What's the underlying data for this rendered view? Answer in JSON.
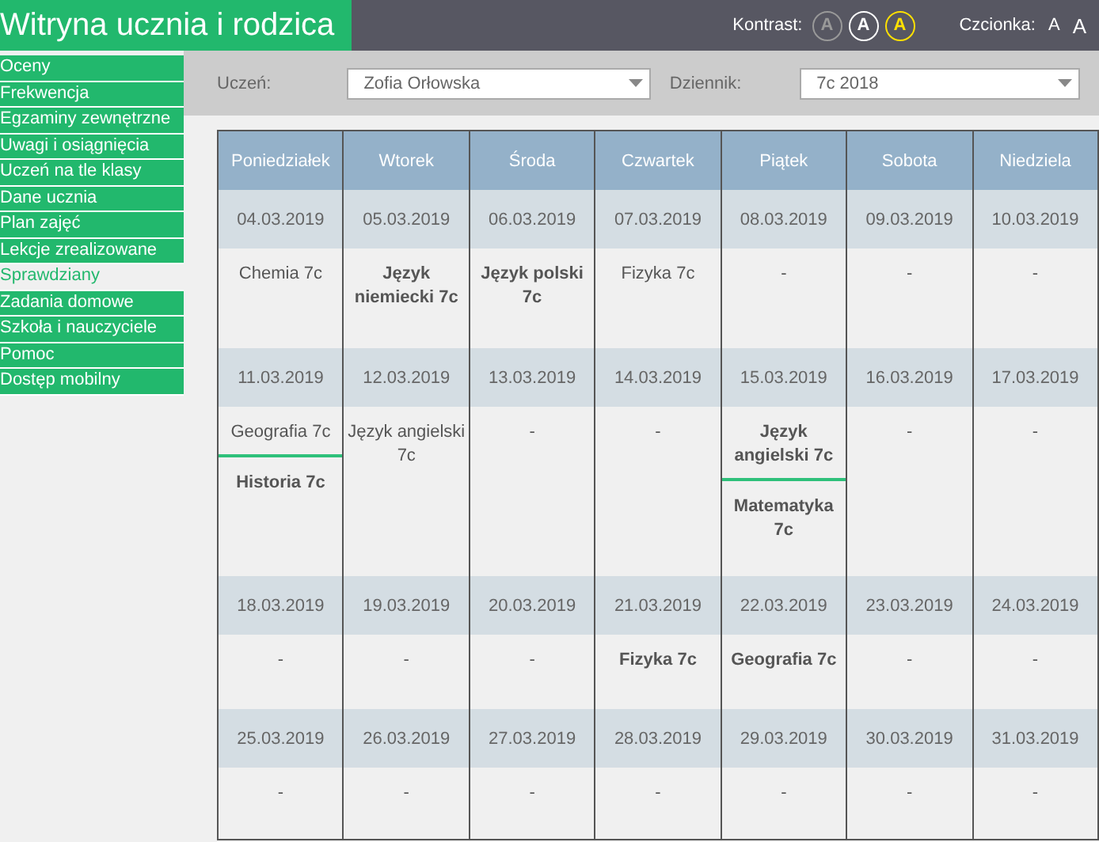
{
  "app_title": "Witryna ucznia i rodzica",
  "contrast": {
    "label": "Kontrast:",
    "options": [
      {
        "text": "A",
        "kind": "dim"
      },
      {
        "text": "A",
        "kind": "normal"
      },
      {
        "text": "A",
        "kind": "yellow"
      }
    ]
  },
  "font_size": {
    "label": "Czcionka:",
    "options": [
      {
        "text": "A",
        "kind": "small"
      },
      {
        "text": "A",
        "kind": "large"
      }
    ]
  },
  "sidebar": {
    "items": [
      {
        "label": "Oceny",
        "selected": false
      },
      {
        "label": "Frekwencja",
        "selected": false
      },
      {
        "label": "Egzaminy zewnętrzne",
        "selected": false
      },
      {
        "label": "Uwagi i osiągnięcia",
        "selected": false
      },
      {
        "label": "Uczeń na tle klasy",
        "selected": false
      },
      {
        "label": "Dane ucznia",
        "selected": false
      },
      {
        "label": "Plan zajęć",
        "selected": false
      },
      {
        "label": "Lekcje zrealizowane",
        "selected": false
      },
      {
        "label": "Sprawdziany",
        "selected": true
      },
      {
        "label": "Zadania domowe",
        "selected": false
      },
      {
        "label": "Szkoła i nauczyciele",
        "selected": false
      },
      {
        "label": "Pomoc",
        "selected": false
      },
      {
        "label": "Dostęp mobilny",
        "selected": false
      }
    ]
  },
  "filters": [
    {
      "label": "Uczeń:",
      "value": "Zofia Orłowska"
    },
    {
      "label": "Dziennik:",
      "value": "7c 2018"
    }
  ],
  "table": {
    "columns": [
      "Poniedziałek",
      "Wtorek",
      "Środa",
      "Czwartek",
      "Piątek",
      "Sobota",
      "Niedziela"
    ],
    "weeks": [
      {
        "dates": [
          "04.03.2019",
          "05.03.2019",
          "06.03.2019",
          "07.03.2019",
          "08.03.2019",
          "09.03.2019",
          "10.03.2019"
        ],
        "days": [
          [
            {
              "text": "Chemia 7c",
              "kind": "normal"
            }
          ],
          [
            {
              "text": "Język niemiecki 7c",
              "kind": "bold"
            }
          ],
          [
            {
              "text": "Język polski 7c",
              "kind": "bold"
            }
          ],
          [
            {
              "text": "Fizyka 7c",
              "kind": "normal"
            }
          ],
          [
            {
              "text": "-",
              "kind": "normal"
            }
          ],
          [
            {
              "text": "-",
              "kind": "normal"
            }
          ],
          [
            {
              "text": "-",
              "kind": "normal"
            }
          ]
        ]
      },
      {
        "dates": [
          "11.03.2019",
          "12.03.2019",
          "13.03.2019",
          "14.03.2019",
          "15.03.2019",
          "16.03.2019",
          "17.03.2019"
        ],
        "days": [
          [
            {
              "text": "Geografia 7c",
              "kind": "normal"
            },
            {
              "text": "Historia 7c",
              "kind": "bold"
            }
          ],
          [
            {
              "text": "Język angielski 7c",
              "kind": "normal"
            }
          ],
          [
            {
              "text": "-",
              "kind": "normal"
            }
          ],
          [
            {
              "text": "-",
              "kind": "normal"
            }
          ],
          [
            {
              "text": "Język angielski 7c",
              "kind": "bold"
            },
            {
              "text": "Matematyka 7c",
              "kind": "bold"
            }
          ],
          [
            {
              "text": "-",
              "kind": "normal"
            }
          ],
          [
            {
              "text": "-",
              "kind": "normal"
            }
          ]
        ]
      },
      {
        "dates": [
          "18.03.2019",
          "19.03.2019",
          "20.03.2019",
          "21.03.2019",
          "22.03.2019",
          "23.03.2019",
          "24.03.2019"
        ],
        "days": [
          [
            {
              "text": "-",
              "kind": "normal"
            }
          ],
          [
            {
              "text": "-",
              "kind": "normal"
            }
          ],
          [
            {
              "text": "-",
              "kind": "normal"
            }
          ],
          [
            {
              "text": "Fizyka 7c",
              "kind": "bold"
            }
          ],
          [
            {
              "text": "Geografia 7c",
              "kind": "bold"
            }
          ],
          [
            {
              "text": "-",
              "kind": "normal"
            }
          ],
          [
            {
              "text": "-",
              "kind": "normal"
            }
          ]
        ]
      },
      {
        "dates": [
          "25.03.2019",
          "26.03.2019",
          "27.03.2019",
          "28.03.2019",
          "29.03.2019",
          "30.03.2019",
          "31.03.2019"
        ],
        "days": [
          [
            {
              "text": "-",
              "kind": "normal"
            }
          ],
          [
            {
              "text": "-",
              "kind": "normal"
            }
          ],
          [
            {
              "text": "-",
              "kind": "normal"
            }
          ],
          [
            {
              "text": "-",
              "kind": "normal"
            }
          ],
          [
            {
              "text": "-",
              "kind": "normal"
            }
          ],
          [
            {
              "text": "-",
              "kind": "normal"
            }
          ],
          [
            {
              "text": "-",
              "kind": "normal"
            }
          ]
        ]
      }
    ]
  }
}
